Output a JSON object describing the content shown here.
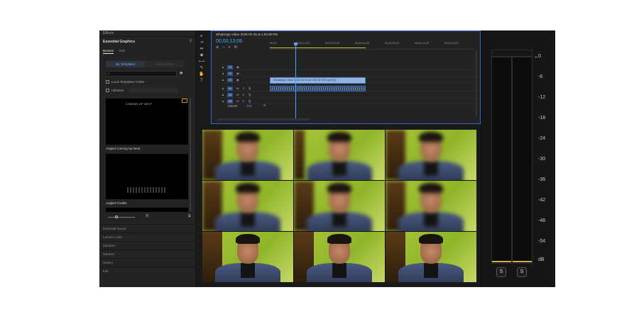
{
  "left_panel": {
    "top_header": "Effects",
    "title": "Essential Graphics",
    "tabs": [
      "Browse",
      "Edit"
    ],
    "segments": [
      "My Templates",
      "Adobe Stock"
    ],
    "checkbox_local": "Local Templates Folder",
    "checkbox_libraries": "Libraries",
    "thumb1_text": "COMING UP NEXT",
    "template1": "Angled Coming Up Next",
    "template2": "Angled Credits",
    "sections": [
      "Essential Sound",
      "Lumetri Color",
      "Libraries",
      "Markers",
      "History",
      "Info"
    ]
  },
  "timeline": {
    "title": "WhatsApp Video 2020-02-26 at 1:03:36 PM",
    "timecode": "00;00;13;08",
    "ticks": [
      "00;00",
      "00;00;14;23",
      "00;00;29;23",
      "00;00;44;22",
      "00;00;59;22",
      "00;01;14;22",
      "00;01;29;21"
    ],
    "video_tracks": [
      "V3",
      "V2",
      "V1"
    ],
    "audio_tracks": [
      "A1",
      "A2",
      "A3"
    ],
    "clip_label": "WhatsApp Video 2020-02-26 at 1:03:36 PM.mp4 [V]",
    "audio_clip_label": "audio waveform",
    "master_label": "Master",
    "master_value": "0.0"
  },
  "meters": {
    "scale": [
      "0",
      "-6",
      "-12",
      "-18",
      "-24",
      "-30",
      "-36",
      "-42",
      "-48",
      "-54",
      "dB"
    ],
    "solo_labels": [
      "S",
      "S"
    ]
  },
  "colors": {
    "accent": "#4aa3ff",
    "timeline_border": "#2f6bd8",
    "workarea": "#d9c230",
    "clip": "#8fb3e3"
  },
  "preview_frames": {
    "rows": [
      {
        "row": 1,
        "blurred": true
      },
      {
        "row": 2,
        "blurred": true
      },
      {
        "row": 3,
        "blurred": false
      }
    ]
  }
}
